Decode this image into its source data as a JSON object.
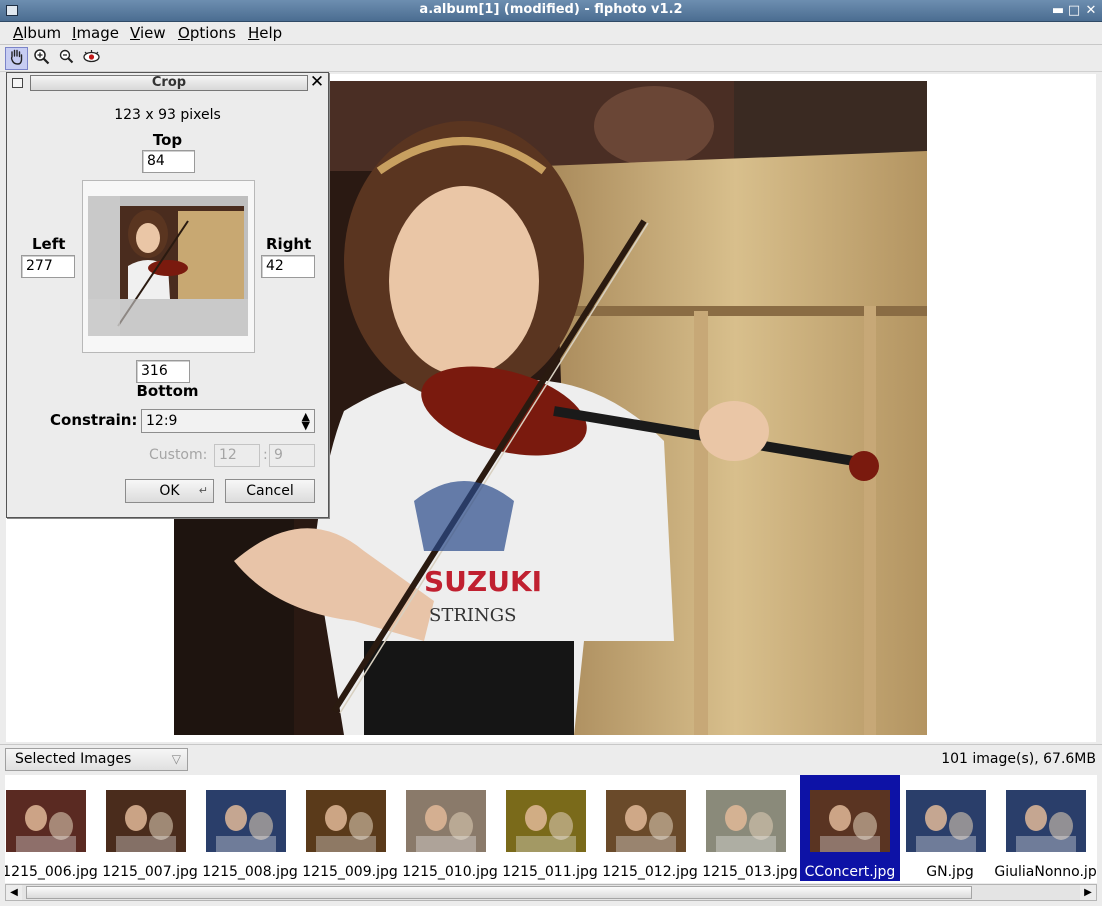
{
  "window": {
    "title": "a.album[1] (modified) - flphoto v1.2"
  },
  "menu": {
    "items": [
      {
        "first": "A",
        "rest": "lbum"
      },
      {
        "first": "I",
        "rest": "mage"
      },
      {
        "first": "V",
        "rest": "iew"
      },
      {
        "first": "O",
        "rest": "ptions"
      },
      {
        "first": "H",
        "rest": "elp"
      }
    ]
  },
  "toolbar": {
    "tools": [
      "hand-tool",
      "zoom-in",
      "zoom-out",
      "red-eye"
    ]
  },
  "crop_dialog": {
    "title": "Crop",
    "size_text": "123 x 93 pixels",
    "top_label": "Top",
    "top_value": "84",
    "left_label": "Left",
    "left_value": "277",
    "right_label": "Right",
    "right_value": "42",
    "bottom_value": "316",
    "bottom_label": "Bottom",
    "constrain_label": "Constrain:",
    "constrain_value": "12:9",
    "custom_label": "Custom:",
    "custom_w": "12",
    "custom_sep": ":",
    "custom_h": "9",
    "ok_label": "OK",
    "cancel_label": "Cancel"
  },
  "selection_bar": {
    "dropdown": "Selected Images",
    "status": "101 image(s), 67.6MB"
  },
  "thumbnails": [
    {
      "label": "1215_006.jpg",
      "selected": false,
      "color": "#5a2a22"
    },
    {
      "label": "1215_007.jpg",
      "selected": false,
      "color": "#4a2c1c"
    },
    {
      "label": "1215_008.jpg",
      "selected": false,
      "color": "#2a3e6a"
    },
    {
      "label": "1215_009.jpg",
      "selected": false,
      "color": "#5a3a1a"
    },
    {
      "label": "1215_010.jpg",
      "selected": false,
      "color": "#8a7a6a"
    },
    {
      "label": "1215_011.jpg",
      "selected": false,
      "color": "#7a6a1a"
    },
    {
      "label": "1215_012.jpg",
      "selected": false,
      "color": "#6a4a2a"
    },
    {
      "label": "1215_013.jpg",
      "selected": false,
      "color": "#8a8a7a"
    },
    {
      "label": "CConcert.jpg",
      "selected": true,
      "color": "#5a3422"
    },
    {
      "label": "GN.jpg",
      "selected": false,
      "color": "#2a3e6a"
    },
    {
      "label": "GiuliaNonno.jpg",
      "selected": false,
      "color": "#2a3e6a"
    }
  ],
  "colors": {
    "titlebar": "#4b6d91",
    "selection": "#0d12a6",
    "tool_active": "#c7cdf2"
  }
}
